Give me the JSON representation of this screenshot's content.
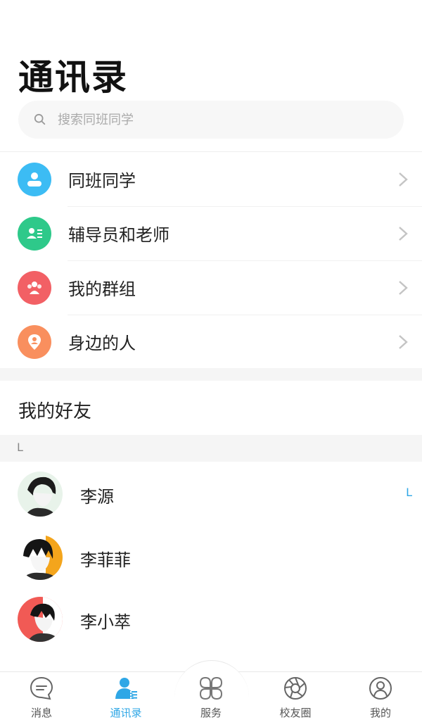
{
  "header": {
    "title": "通讯录"
  },
  "search": {
    "placeholder": "搜索同班同学"
  },
  "menu": [
    {
      "label": "同班同学",
      "icon": "classmates-icon",
      "color": "#3cbcf4"
    },
    {
      "label": "辅导员和老师",
      "icon": "teacher-card-icon",
      "color": "#2ec98a"
    },
    {
      "label": "我的群组",
      "icon": "group-icon",
      "color": "#f26065"
    },
    {
      "label": "身边的人",
      "icon": "location-person-icon",
      "color": "#f98f5e"
    }
  ],
  "friends": {
    "title": "我的好友",
    "section_letter": "L",
    "items": [
      {
        "name": "李源"
      },
      {
        "name": "李菲菲"
      },
      {
        "name": "李小萃"
      }
    ],
    "index_letter": "L"
  },
  "tabbar": {
    "active": "通讯录",
    "accent": "#2fa7e6",
    "items": [
      {
        "label": "消息",
        "icon": "message-icon"
      },
      {
        "label": "通讯录",
        "icon": "contacts-icon"
      },
      {
        "label": "服务",
        "icon": "services-icon"
      },
      {
        "label": "校友圈",
        "icon": "aperture-icon"
      },
      {
        "label": "我的",
        "icon": "profile-icon"
      }
    ]
  }
}
